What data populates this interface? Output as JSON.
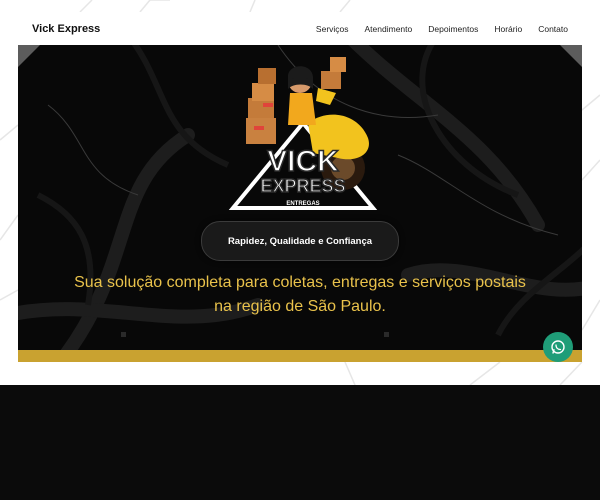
{
  "navbar": {
    "brand": "Vick Express",
    "links": [
      "Serviços",
      "Atendimento",
      "Depoimentos",
      "Horário",
      "Contato"
    ]
  },
  "hero": {
    "logo": {
      "title": "VICK",
      "subtitle": "EXPRESS",
      "tag": "ENTREGAS"
    },
    "tagline": "Rapidez, Qualidade e Confiança",
    "description": "Sua solução completa para coletas, entregas e serviços postais na região de São Paulo."
  },
  "colors": {
    "accent_gold": "#c9a230",
    "description_yellow": "#e9c24b",
    "hero_bg": "#080808",
    "whatsapp_green": "#1f9d78"
  },
  "icons": [
    "whatsapp-icon"
  ]
}
